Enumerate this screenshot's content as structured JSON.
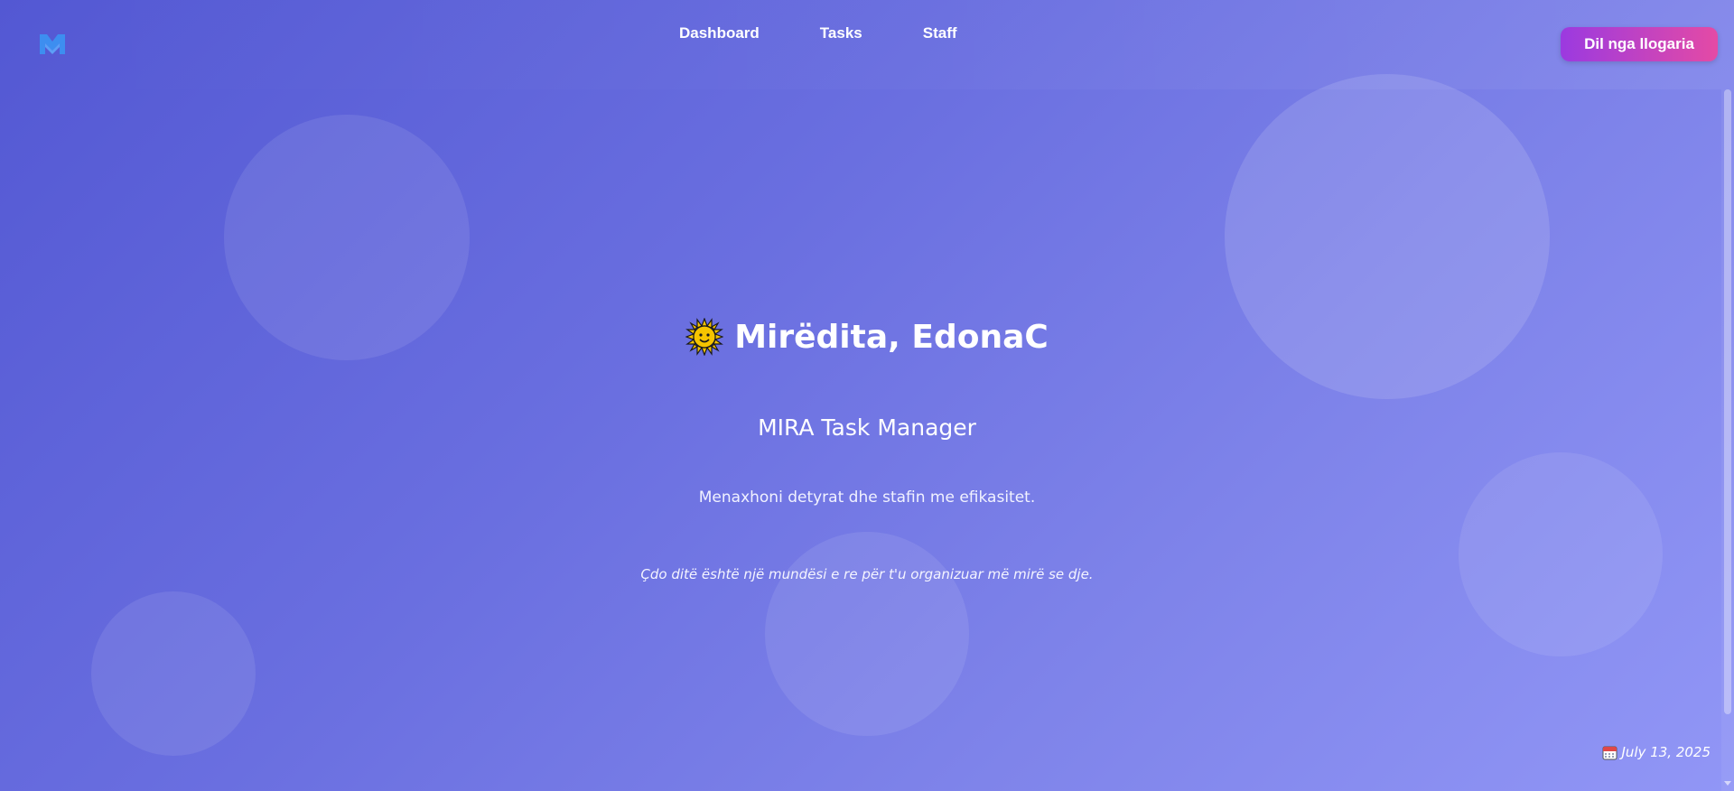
{
  "header": {
    "logo_icon": "mira-logo-icon",
    "nav": [
      "Dashboard",
      "Tasks",
      "Staff"
    ],
    "logout_label": "Dil nga llogaria"
  },
  "hero": {
    "greeting_icon": "sun-face-icon",
    "greeting": "Mirëdita, EdonaC",
    "app_title": "MIRA Task Manager",
    "tagline": "Menaxhoni detyrat dhe stafin me efikasitet.",
    "quote": "Çdo ditë është një mundësi e re për t'u organizuar më mirë se dje."
  },
  "footer": {
    "calendar_icon": "calendar-icon",
    "date": "July 13, 2025"
  },
  "colors": {
    "bg_start": "#5358d3",
    "bg_end": "#9196f6",
    "button_start": "#9b3ae0",
    "button_end": "#e44aa5",
    "logo": "#3d8ef0"
  }
}
